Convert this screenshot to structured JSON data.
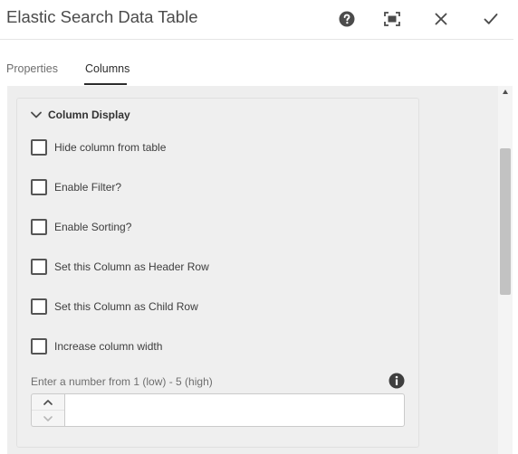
{
  "dialog": {
    "title": "Elastic Search Data Table",
    "header_icons": [
      "help-icon",
      "fullscreen-icon",
      "close-icon",
      "done-check-icon"
    ]
  },
  "tabs": [
    {
      "label": "Properties",
      "active": false
    },
    {
      "label": "Columns",
      "active": true
    }
  ],
  "section": {
    "title": "Column Display",
    "expanded": true
  },
  "checkboxes": [
    {
      "label": "Hide column from table",
      "checked": false
    },
    {
      "label": "Enable Filter?",
      "checked": false
    },
    {
      "label": "Enable Sorting?",
      "checked": false
    },
    {
      "label": "Set this Column as Header Row",
      "checked": false
    },
    {
      "label": "Set this Column as Child Row",
      "checked": false
    },
    {
      "label": "Increase column width",
      "checked": false
    }
  ],
  "number_field": {
    "label": "Enter a number from 1 (low) - 5 (high)",
    "value": ""
  },
  "colors": {
    "content_bg": "#eeeeee",
    "active_tab": "#2c2c2c",
    "text": "#4b4b4b"
  }
}
